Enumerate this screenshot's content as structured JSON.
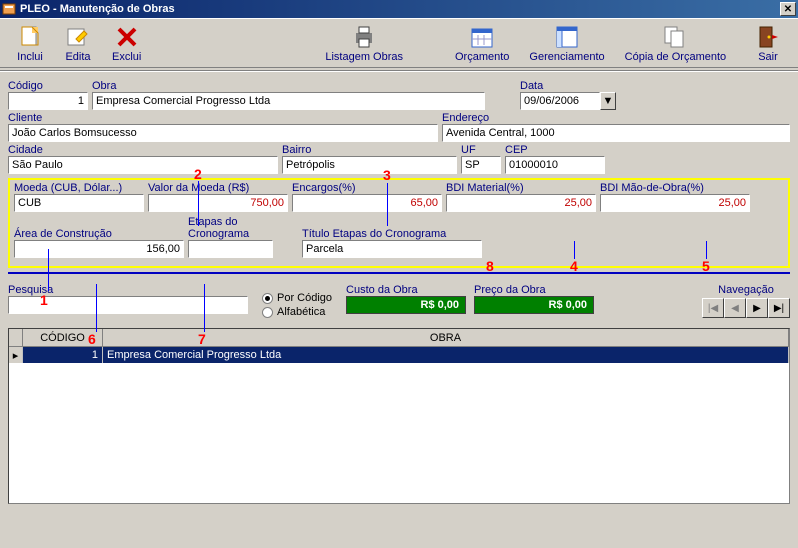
{
  "title": "PLEO - Manutenção de Obras",
  "toolbar": {
    "inclui": "Inclui",
    "edita": "Edita",
    "exclui": "Exclui",
    "listagem_obras": "Listagem Obras",
    "orcamento": "Orçamento",
    "gerenciamento": "Gerenciamento",
    "copia_orcamento": "Cópia de Orçamento",
    "sair": "Sair"
  },
  "fields": {
    "codigo_label": "Código",
    "codigo_value": "1",
    "obra_label": "Obra",
    "obra_value": "Empresa Comercial Progresso Ltda",
    "data_label": "Data",
    "data_value": "09/06/2006",
    "cliente_label": "Cliente",
    "cliente_value": "João Carlos Bomsucesso",
    "endereco_label": "Endereço",
    "endereco_value": "Avenida Central, 1000",
    "cidade_label": "Cidade",
    "cidade_value": "São Paulo",
    "bairro_label": "Bairro",
    "bairro_value": "Petrópolis",
    "uf_label": "UF",
    "uf_value": "SP",
    "cep_label": "CEP",
    "cep_value": "01000010",
    "moeda_label": "Moeda (CUB, Dólar...)",
    "moeda_value": "CUB",
    "valor_moeda_label": "Valor da Moeda (R$)",
    "valor_moeda_value": "750,00",
    "encargos_label": "Encargos(%)",
    "encargos_value": "65,00",
    "bdi_material_label": "BDI Material(%)",
    "bdi_material_value": "25,00",
    "bdi_mao_obra_label": "BDI Mão-de-Obra(%)",
    "bdi_mao_obra_value": "25,00",
    "area_label": "Área de Construção",
    "area_value": "156,00",
    "etapas_label": "Etapas do Cronograma",
    "etapas_value": "",
    "titulo_etapas_label": "Título Etapas do Cronograma",
    "titulo_etapas_value": "Parcela"
  },
  "pesquisa": {
    "label": "Pesquisa",
    "value": "",
    "por_codigo": "Por Código",
    "alfabetica": "Alfabética"
  },
  "costs": {
    "custo_label": "Custo da Obra",
    "custo_value": "R$ 0,00",
    "preco_label": "Preço da Obra",
    "preco_value": "R$ 0,00"
  },
  "nav": {
    "label": "Navegação"
  },
  "grid": {
    "col_codigo": "CÓDIGO",
    "col_obra": "OBRA",
    "row1_codigo": "1",
    "row1_obra": "Empresa Comercial Progresso Ltda"
  },
  "markers": {
    "m1": "1",
    "m2": "2",
    "m3": "3",
    "m4": "4",
    "m5": "5",
    "m6": "6",
    "m7": "7",
    "m8": "8"
  }
}
